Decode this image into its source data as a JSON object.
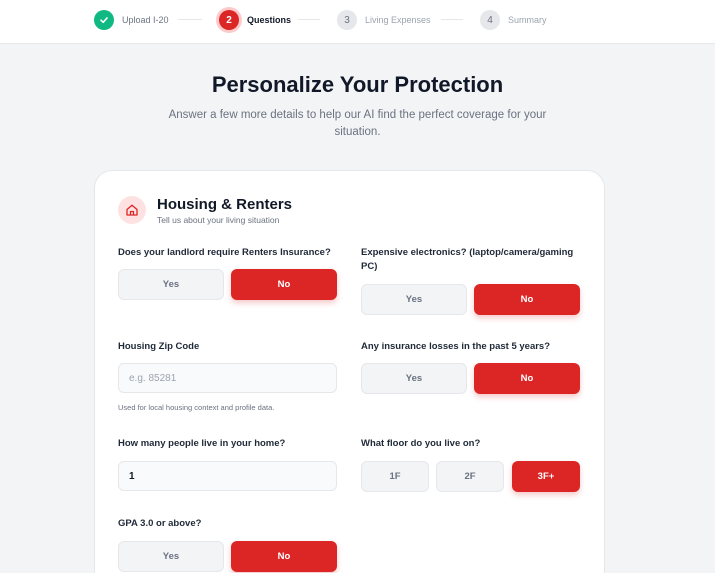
{
  "stepper": {
    "steps": [
      {
        "number": "1",
        "label": "Upload I-20",
        "state": "done",
        "icon": "check-icon"
      },
      {
        "number": "2",
        "label": "Questions",
        "state": "active"
      },
      {
        "number": "3",
        "label": "Living Expenses",
        "state": "todo"
      },
      {
        "number": "4",
        "label": "Summary",
        "state": "todo"
      }
    ]
  },
  "header": {
    "title": "Personalize Your Protection",
    "subtitle": "Answer a few more details to help our AI find the perfect coverage for your situation."
  },
  "section": {
    "icon": "house-icon",
    "title": "Housing & Renters",
    "subtitle": "Tell us about your living situation"
  },
  "questions": {
    "renters": {
      "label": "Does your landlord require Renters Insurance?",
      "options": [
        "Yes",
        "No"
      ],
      "selected": "No"
    },
    "electronics": {
      "label": "Expensive electronics? (laptop/camera/gaming PC)",
      "options": [
        "Yes",
        "No"
      ],
      "selected": "No"
    },
    "zip": {
      "label": "Housing Zip Code",
      "value": "",
      "placeholder": "e.g. 85281",
      "help": "Used for local housing context and profile data."
    },
    "losses": {
      "label": "Any insurance losses in the past 5 years?",
      "options": [
        "Yes",
        "No"
      ],
      "selected": "No"
    },
    "people": {
      "label": "How many people live in your home?",
      "value": "1"
    },
    "floor": {
      "label": "What floor do you live on?",
      "options": [
        "1F",
        "2F",
        "3F+"
      ],
      "selected": "3F+"
    },
    "gpa": {
      "label": "GPA 3.0 or above?",
      "options": [
        "Yes",
        "No"
      ],
      "selected": "No"
    }
  },
  "colors": {
    "accent": "#dc2626",
    "success": "#10b981",
    "accent_light": "#fee2e2"
  }
}
